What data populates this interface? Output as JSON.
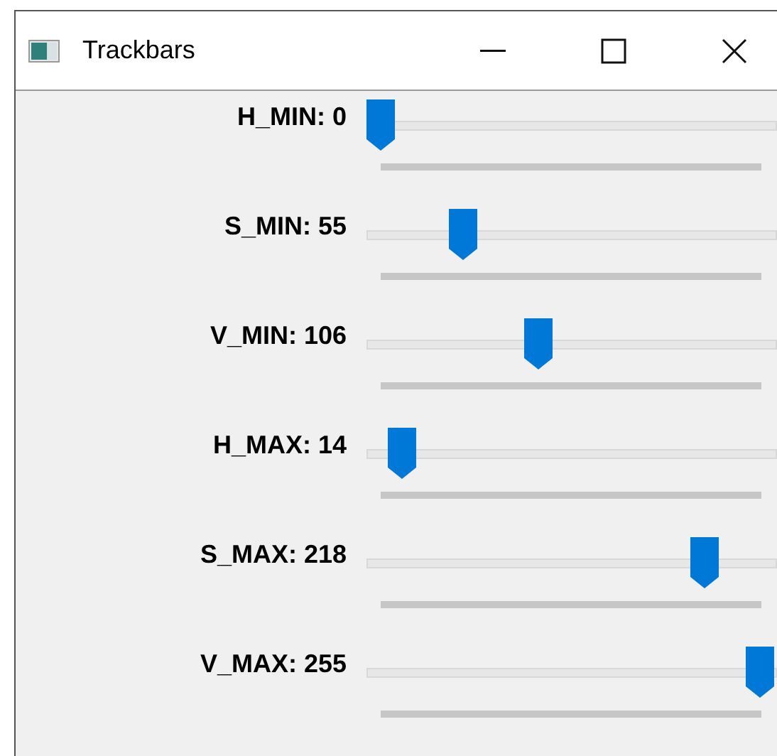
{
  "window": {
    "title": "Trackbars"
  },
  "trackbars": [
    {
      "label": "H_MIN: 0",
      "level": 0
    },
    {
      "label": "S_MIN: 55",
      "level": 0.2157
    },
    {
      "label": "V_MIN: 106",
      "level": 0.4157
    },
    {
      "label": "H_MAX: 14",
      "level": 0.0549
    },
    {
      "label": "S_MAX: 218",
      "level": 0.8549
    },
    {
      "label": "V_MAX: 255",
      "level": 1
    }
  ]
}
